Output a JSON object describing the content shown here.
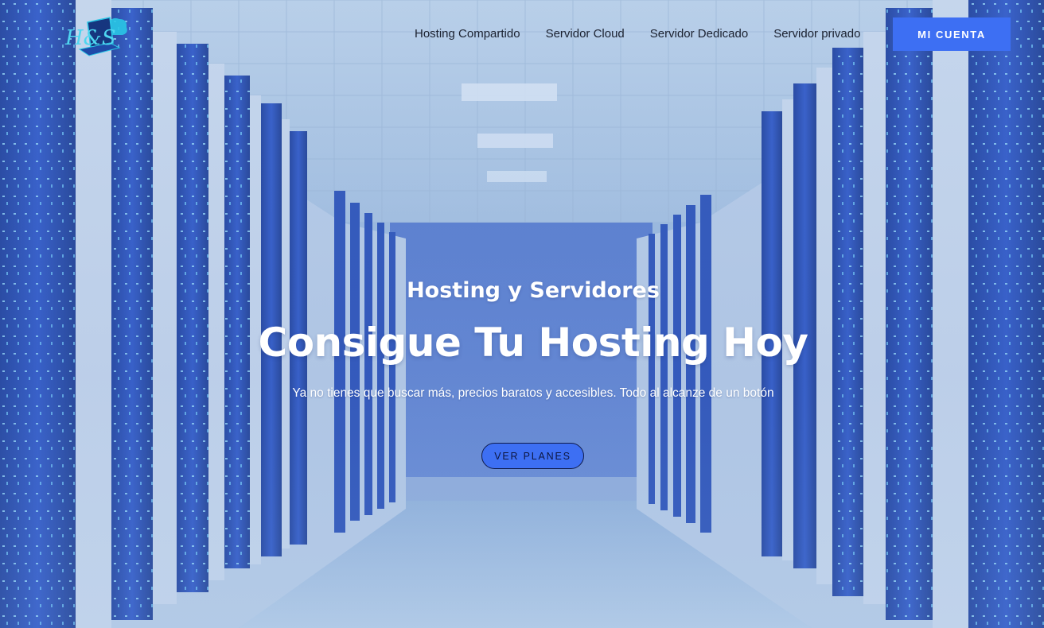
{
  "header": {
    "logo_text": "H&S",
    "nav": [
      {
        "label": "Hosting Compartido"
      },
      {
        "label": "Servidor Cloud"
      },
      {
        "label": "Servidor Dedicado"
      },
      {
        "label": "Servidor privado"
      }
    ],
    "account_button": "MI CUENTA"
  },
  "hero": {
    "kicker": "Hosting y Servidores",
    "title": "Consigue Tu Hosting Hoy",
    "subtitle": "Ya no tienes que buscar más, precios baratos y accesibles. Todo al alcanze de un botón",
    "cta": "VER PLANES"
  },
  "colors": {
    "accent": "#3d6ff3",
    "nav_text": "#1b2130",
    "hero_text": "#ffffff",
    "logo_cyan": "#29c6e6"
  },
  "icons": {
    "logo": "laptop-cloud-logo-icon"
  }
}
